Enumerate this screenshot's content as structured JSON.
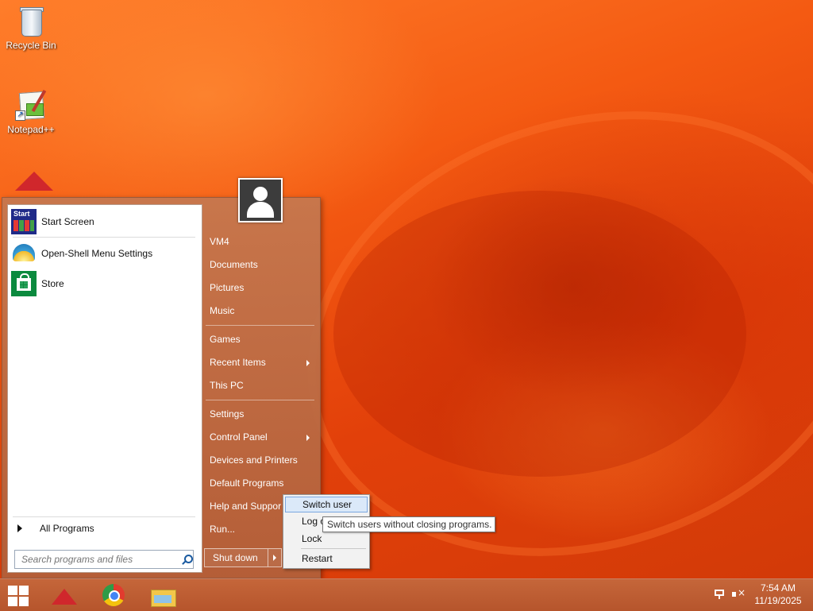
{
  "desktop": {
    "icons": [
      {
        "label": "Recycle Bin",
        "icon": "recycle-bin-icon"
      },
      {
        "label": "Notepad++",
        "icon": "notepad-plus-plus-icon"
      },
      {
        "label": "",
        "icon": "app-kite-icon"
      }
    ]
  },
  "start_menu": {
    "pinned": [
      {
        "label": "Start Screen",
        "icon": "start-screen-icon"
      },
      {
        "label": "Open-Shell Menu Settings",
        "icon": "open-shell-icon"
      },
      {
        "label": "Store",
        "icon": "store-icon"
      }
    ],
    "all_programs": "All Programs",
    "search_placeholder": "Search programs and files",
    "user": {
      "name": "VM4",
      "icon": "user-avatar-icon"
    },
    "right_items": {
      "documents": "Documents",
      "pictures": "Pictures",
      "music": "Music",
      "games": "Games",
      "recent_items": "Recent Items",
      "this_pc": "This PC",
      "settings": "Settings",
      "control_panel": "Control Panel",
      "devices_printers": "Devices and Printers",
      "default_programs": "Default Programs",
      "help_support": "Help and Suppor",
      "run": "Run..."
    },
    "shutdown": "Shut down",
    "shutdown_submenu": {
      "switch_user": "Switch user",
      "log_off": "Log o",
      "lock": "Lock",
      "restart": "Restart"
    },
    "tooltip": "Switch users without closing programs."
  },
  "taskbar": {
    "pinned": [
      "app-kite-icon",
      "chrome-icon",
      "file-explorer-icon"
    ],
    "clock": {
      "time": "7:54 AM",
      "date": "11/19/2025"
    }
  },
  "colors": {
    "wallpaper": "#f45a12",
    "taskbar": "#b6552c",
    "menu_highlight": "#dbe9f9"
  }
}
